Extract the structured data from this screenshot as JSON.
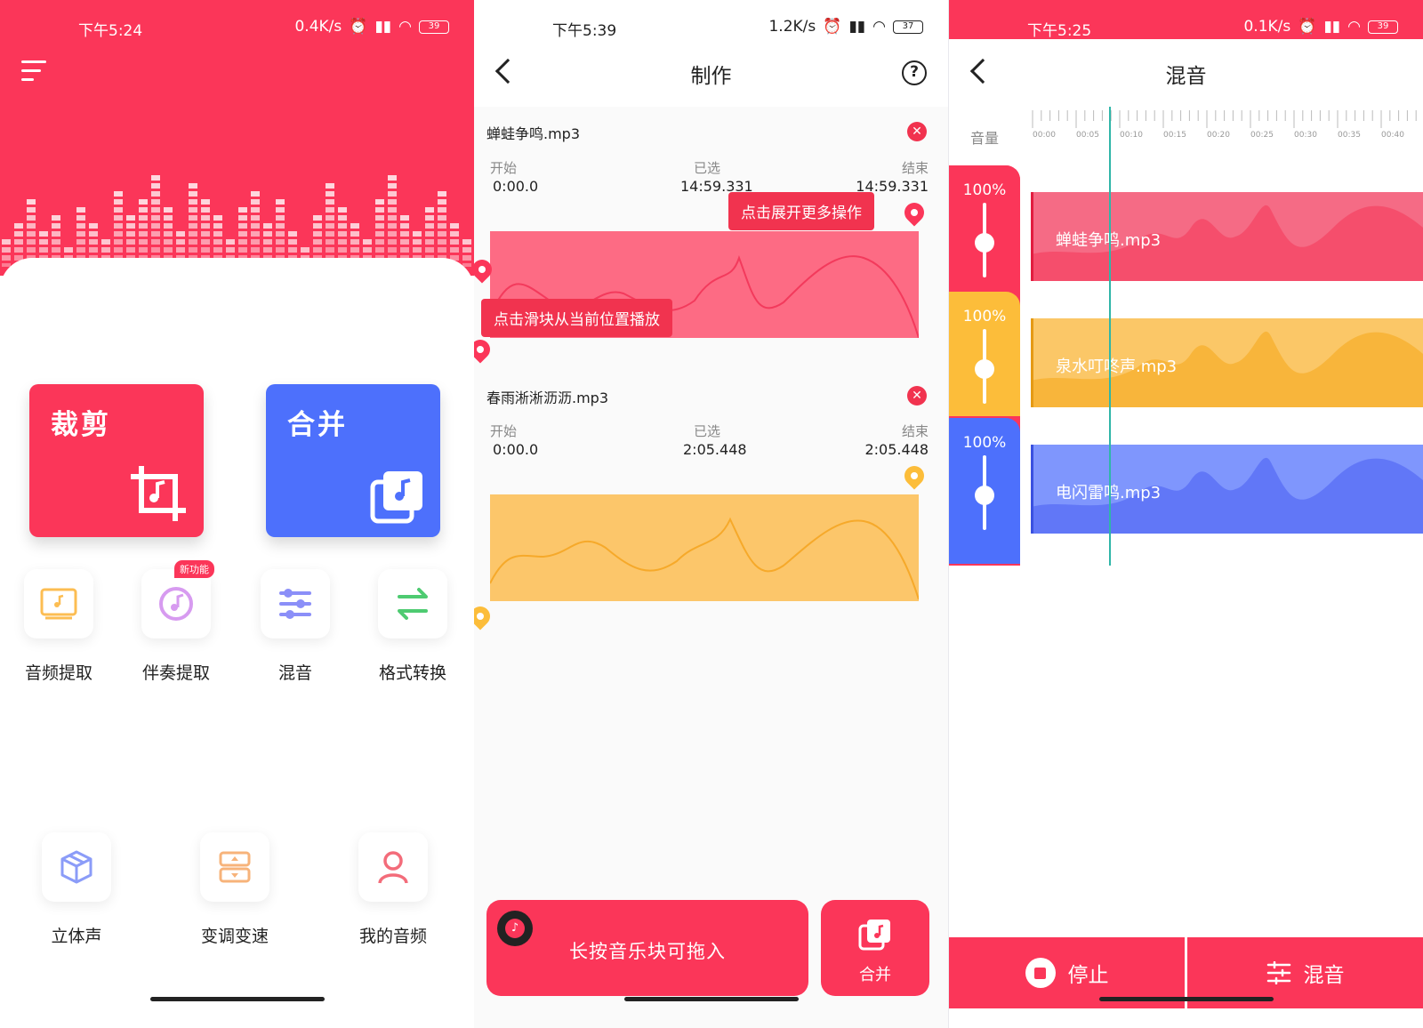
{
  "colors": {
    "brand": "#fb3659",
    "blue": "#4d70fc",
    "orange": "#fcbd52",
    "teal": "#2fb6a8"
  },
  "home": {
    "status": {
      "time": "下午5:24",
      "speed": "0.4K/s",
      "battery": "39"
    },
    "cards": [
      {
        "label": "裁剪",
        "icon": "crop-music-icon"
      },
      {
        "label": "合并",
        "icon": "merge-music-icon"
      }
    ],
    "tools_row1": [
      {
        "label": "音频提取",
        "icon": "audio-extract-icon"
      },
      {
        "label": "伴奏提取",
        "icon": "accompaniment-icon",
        "badge": "新功能"
      },
      {
        "label": "混音",
        "icon": "mixer-sliders-icon"
      },
      {
        "label": "格式转换",
        "icon": "convert-arrows-icon"
      }
    ],
    "tools_row2": [
      {
        "label": "立体声",
        "icon": "cube-icon"
      },
      {
        "label": "变调变速",
        "icon": "pitch-speed-icon"
      },
      {
        "label": "我的音频",
        "icon": "user-icon"
      }
    ]
  },
  "make": {
    "status": {
      "time": "下午5:39",
      "speed": "1.2K/s",
      "battery": "37"
    },
    "title": "制作",
    "tracks": [
      {
        "name": "蝉蛙争鸣.mp3",
        "start_label": "开始",
        "start": "0:00.0",
        "sel_label": "已选",
        "sel": "14:59.331",
        "end_label": "结束",
        "end": "14:59.331"
      },
      {
        "name": "春雨淅淅沥沥.mp3",
        "start_label": "开始",
        "start": "0:00.0",
        "sel_label": "已选",
        "sel": "2:05.448",
        "end_label": "结束",
        "end": "2:05.448"
      }
    ],
    "tip_more": "点击展开更多操作",
    "tip_play": "点击滑块从当前位置播放",
    "drag_hint": "长按音乐块可拖入",
    "merge_label": "合并"
  },
  "mix": {
    "status": {
      "time": "下午5:25",
      "speed": "0.1K/s",
      "battery": "39"
    },
    "title": "混音",
    "volume_label": "音量",
    "ruler": [
      "00:00",
      "00:05",
      "00:10",
      "00:15",
      "00:20",
      "00:25",
      "00:30",
      "00:35",
      "00:40"
    ],
    "tracks": [
      {
        "name": "蝉蛙争鸣.mp3",
        "volume": "100%"
      },
      {
        "name": "泉水叮咚声.mp3",
        "volume": "100%"
      },
      {
        "name": "电闪雷鸣.mp3",
        "volume": "100%"
      }
    ],
    "stop_label": "停止",
    "mix_label": "混音"
  }
}
